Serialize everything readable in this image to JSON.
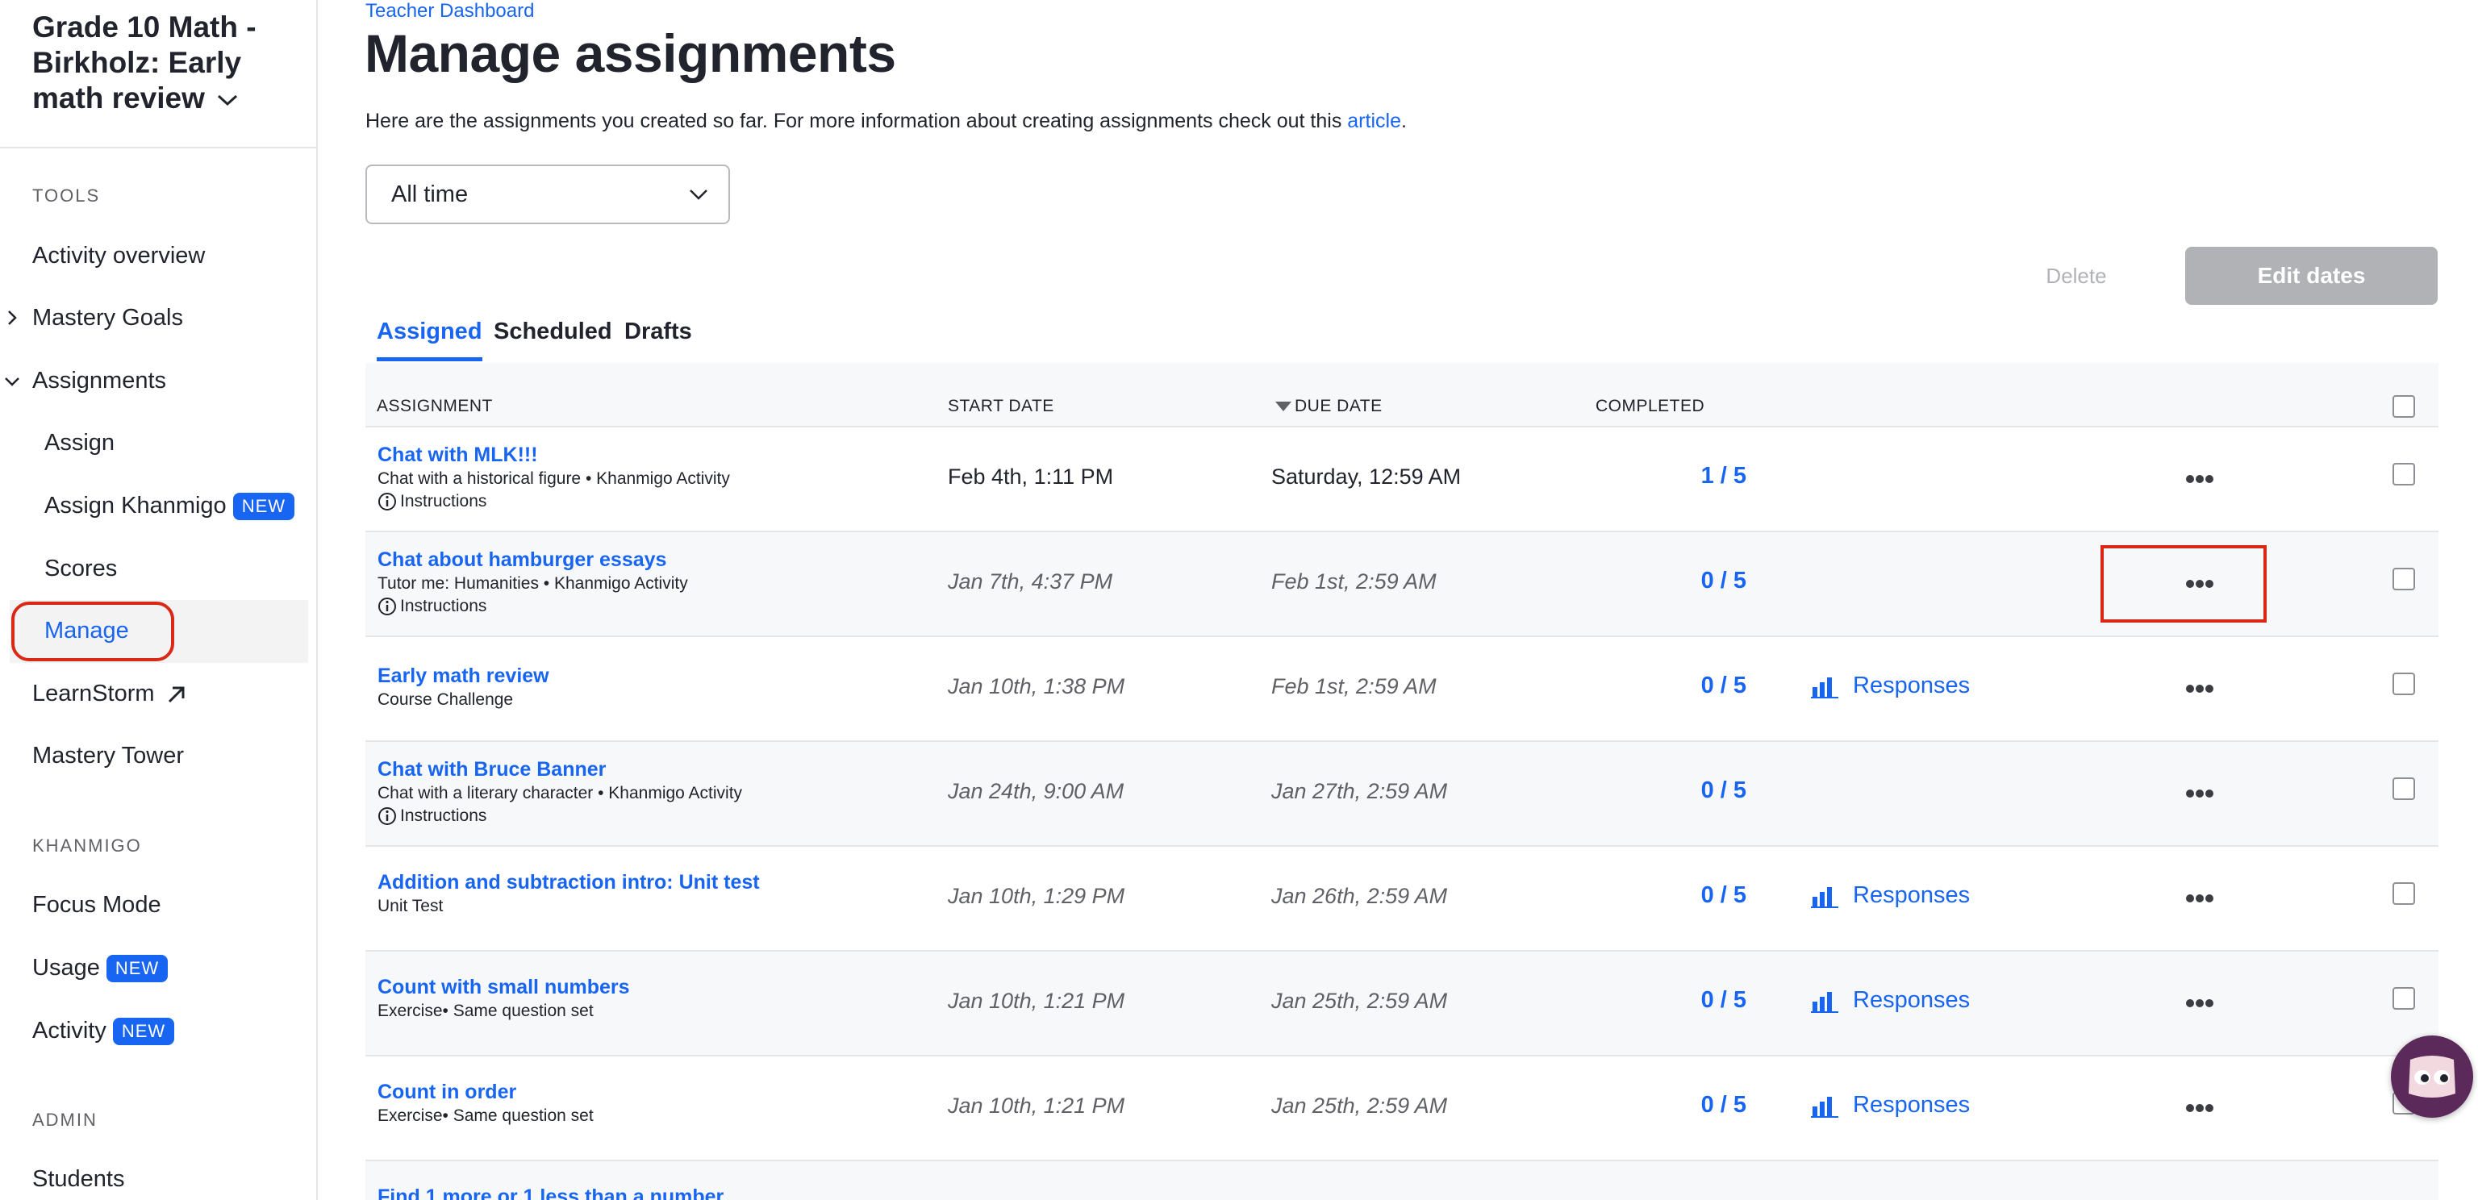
{
  "sidebar": {
    "class_title": "Grade 10 Math - Birkholz: Early math review",
    "sections": {
      "tools": "TOOLS",
      "khanmigo": "KHANMIGO",
      "admin": "ADMIN"
    },
    "items": {
      "activity_overview": "Activity overview",
      "mastery_goals": "Mastery Goals",
      "assignments": "Assignments",
      "assign": "Assign",
      "assign_khanmigo": "Assign Khanmigo",
      "scores": "Scores",
      "manage": "Manage",
      "learnstorm": "LearnStorm",
      "mastery_tower": "Mastery Tower",
      "focus_mode": "Focus Mode",
      "usage": "Usage",
      "activity": "Activity",
      "students": "Students"
    },
    "new_badge": "NEW"
  },
  "header": {
    "breadcrumb": "Teacher Dashboard",
    "title": "Manage assignments",
    "intro_text": "Here are the assignments you created so far. For more information about creating assignments check out this ",
    "intro_link": "article",
    "intro_end": "."
  },
  "filter": {
    "selected": "All time"
  },
  "actions": {
    "delete": "Delete",
    "edit_dates": "Edit dates"
  },
  "tabs": {
    "assigned": "Assigned",
    "scheduled": "Scheduled",
    "drafts": "Drafts"
  },
  "table": {
    "headers": {
      "assignment": "ASSIGNMENT",
      "start_date": "START DATE",
      "due_date": "DUE DATE",
      "completed": "COMPLETED"
    },
    "instructions_label": "Instructions",
    "responses_label": "Responses",
    "rows": [
      {
        "title": "Chat with MLK!!!",
        "subtitle": "Chat with a historical figure • Khanmigo Activity",
        "start": "Feb 4th, 1:11 PM",
        "due": "Saturday, 12:59 AM",
        "completed": "1 / 5"
      },
      {
        "title": "Chat about hamburger essays",
        "subtitle": "Tutor me: Humanities • Khanmigo Activity",
        "start": "Jan 7th, 4:37 PM",
        "due": "Feb 1st, 2:59 AM",
        "completed": "0 / 5"
      },
      {
        "title": "Early math review",
        "subtitle": "Course Challenge",
        "start": "Jan 10th, 1:38 PM",
        "due": "Feb 1st, 2:59 AM",
        "completed": "0 / 5"
      },
      {
        "title": "Chat with Bruce Banner",
        "subtitle": "Chat with a literary character • Khanmigo Activity",
        "start": "Jan 24th, 9:00 AM",
        "due": "Jan 27th, 2:59 AM",
        "completed": "0 / 5"
      },
      {
        "title": "Addition and subtraction intro: Unit test",
        "subtitle": "Unit Test",
        "start": "Jan 10th, 1:29 PM",
        "due": "Jan 26th, 2:59 AM",
        "completed": "0 / 5"
      },
      {
        "title": "Count with small numbers",
        "subtitle": "Exercise• Same question set",
        "start": "Jan 10th, 1:21 PM",
        "due": "Jan 25th, 2:59 AM",
        "completed": "0 / 5"
      },
      {
        "title": "Count in order",
        "subtitle": "Exercise• Same question set",
        "start": "Jan 10th, 1:21 PM",
        "due": "Jan 25th, 2:59 AM",
        "completed": "0 / 5"
      },
      {
        "title": "Find 1 more or 1 less than a number"
      }
    ]
  },
  "colors": {
    "accent": "#1865f2",
    "highlight_ring": "#d92916",
    "disabled": "#b0b2b6"
  }
}
